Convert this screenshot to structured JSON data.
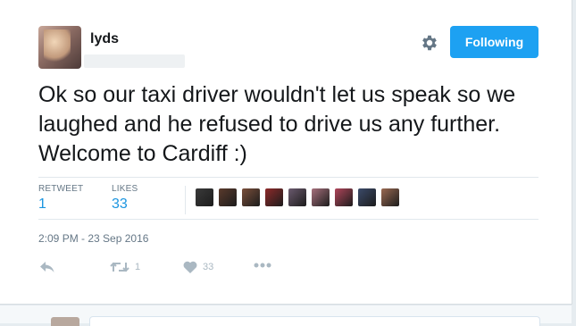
{
  "user": {
    "name": "lyds"
  },
  "header": {
    "follow_label": "Following"
  },
  "tweet": {
    "text": "Ok so our taxi driver wouldn't let us speak so we laughed and he refused to drive us any further. Welcome to Cardiff :)",
    "timestamp": "2:09 PM - 23 Sep 2016"
  },
  "stats": {
    "retweets_label": "RETWEET",
    "retweets_value": "1",
    "likes_label": "LIKES",
    "likes_value": "33"
  },
  "likers": [
    {
      "icon": "liker-avatar",
      "color": "#3a3a3a"
    },
    {
      "icon": "liker-avatar",
      "color": "#5a3a2c"
    },
    {
      "icon": "liker-avatar",
      "color": "#7a4e3a"
    },
    {
      "icon": "liker-avatar",
      "color": "#8e2a2a"
    },
    {
      "icon": "liker-avatar",
      "color": "#6b5a6e"
    },
    {
      "icon": "liker-avatar",
      "color": "#a6707c"
    },
    {
      "icon": "liker-avatar",
      "color": "#b0455a"
    },
    {
      "icon": "liker-avatar",
      "color": "#3b4a6a"
    },
    {
      "icon": "liker-avatar",
      "color": "#9a6a52"
    }
  ],
  "actions": {
    "reply_icon": "reply-icon",
    "retweet_icon": "retweet-icon",
    "retweet_count": "1",
    "like_icon": "heart-icon",
    "like_count": "33",
    "more_icon": "more-icon"
  },
  "colors": {
    "accent": "#1da1f2",
    "link": "#1b95e0",
    "muted": "#657786",
    "icon": "#aab8c2"
  }
}
